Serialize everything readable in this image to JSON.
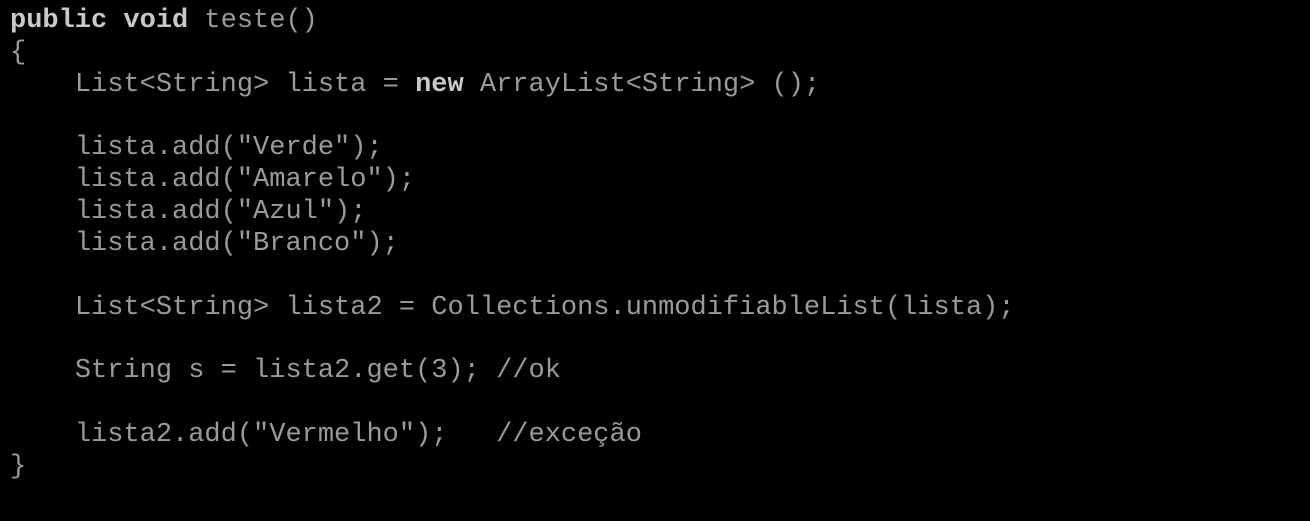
{
  "code": {
    "kw_public": "public",
    "kw_void": "void",
    "method_sig": " teste()",
    "open_brace": "{",
    "indent": "    ",
    "decl1_a": "List<String> lista = ",
    "kw_new": "new",
    "decl1_b": " ArrayList<String> ();",
    "add1": "lista.add(\"Verde\");",
    "add2": "lista.add(\"Amarelo\");",
    "add3": "lista.add(\"Azul\");",
    "add4": "lista.add(\"Branco\");",
    "decl2": "List<String> lista2 = Collections.unmodifiableList(lista);",
    "get_line": "String s = lista2.get(3); //ok",
    "add_err": "lista2.add(\"Vermelho\");   //exceção",
    "close_brace": "}"
  }
}
